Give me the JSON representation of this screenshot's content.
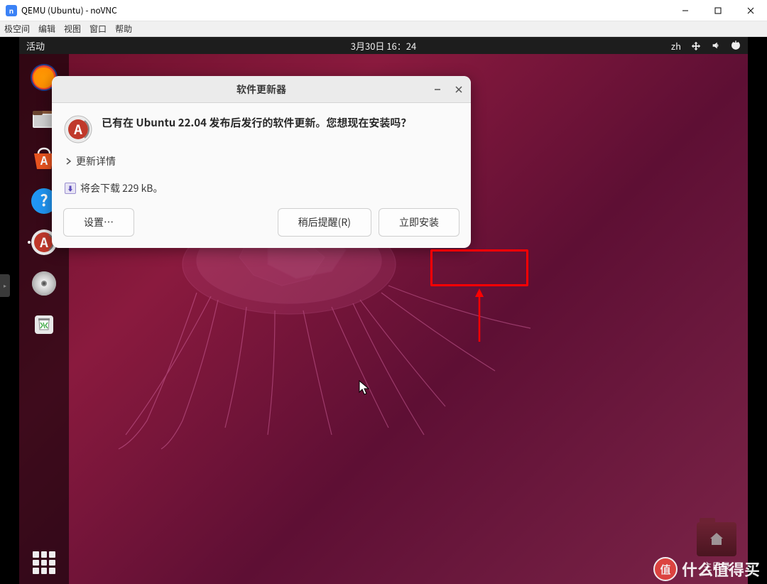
{
  "window": {
    "title": "QEMU (Ubuntu) - noVNC"
  },
  "vnc_menu": [
    "极空间",
    "编辑",
    "视图",
    "窗口",
    "帮助"
  ],
  "topbar": {
    "activities": "活动",
    "datetime": "3月30日  16：24",
    "lang": "zh"
  },
  "dialog": {
    "title": "软件更新器",
    "message": "已有在 Ubuntu 22.04 发布后发行的软件更新。您想现在安装吗？",
    "details": "更新详情",
    "download_info": "将会下载 229 kB。",
    "settings_btn": "设置…",
    "later_btn": "稍后提醒(R)",
    "install_btn": "立即安装"
  },
  "desktop": {
    "home_label": "主目录"
  },
  "watermark": {
    "badge": "值",
    "text": "什么值得买"
  }
}
